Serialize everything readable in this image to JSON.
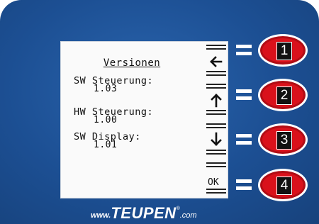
{
  "display": {
    "title": "Versionen",
    "entries": [
      {
        "label": "SW Steuerung:",
        "value": "1.03"
      },
      {
        "label": "HW Steuerung:",
        "value": "1.00"
      },
      {
        "label": "SW Display:",
        "value": "1.01"
      }
    ],
    "softkeys": [
      {
        "icon": "arrow-left-icon",
        "label": ""
      },
      {
        "icon": "arrow-up-icon",
        "label": ""
      },
      {
        "icon": "arrow-down-icon",
        "label": ""
      },
      {
        "icon": "",
        "label": "OK"
      }
    ]
  },
  "buttons": [
    {
      "number": "1"
    },
    {
      "number": "2"
    },
    {
      "number": "3"
    },
    {
      "number": "4"
    }
  ],
  "logo": {
    "prefix": "www.",
    "brand": "TEUPEN",
    "registered": "®",
    "suffix": ".com"
  },
  "colors": {
    "panel": "#1c4f93",
    "button_red": "#d9111b",
    "lcd_background": "#fafafa"
  }
}
